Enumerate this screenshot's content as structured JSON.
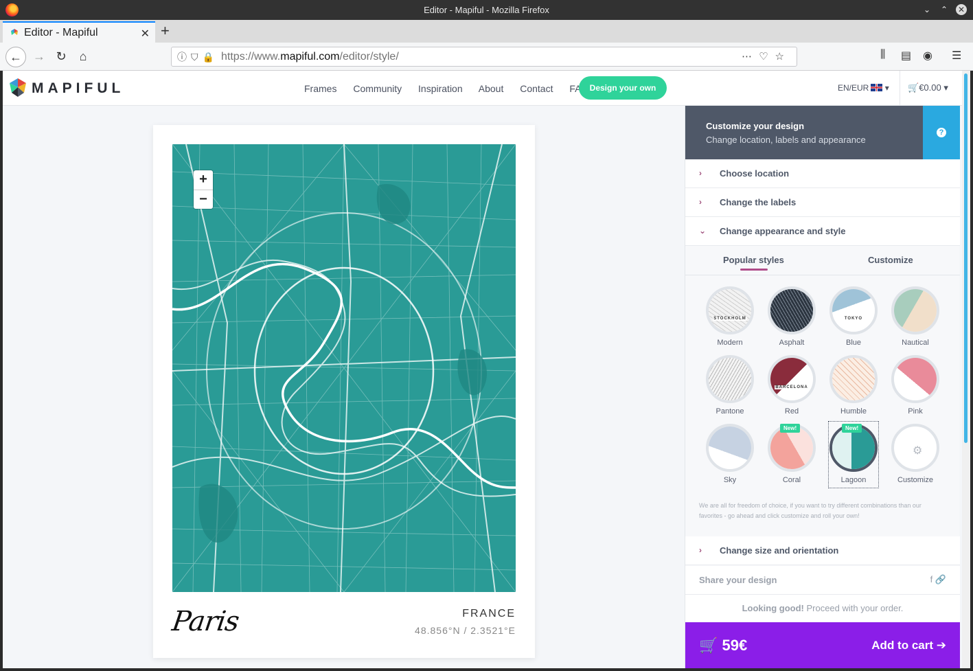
{
  "window": {
    "title": "Editor - Mapiful - Mozilla Firefox"
  },
  "browser": {
    "tab_title": "Editor - Mapiful",
    "url_prefix": "https://www.",
    "url_host": "mapiful.com",
    "url_path": "/editor/style/"
  },
  "site": {
    "brand": "MAPIFUL",
    "nav": [
      "Frames",
      "Community",
      "Inspiration",
      "About",
      "Contact",
      "FAQ"
    ],
    "cta": "Design your own",
    "lang": "EN/EUR",
    "cart": "€0.00"
  },
  "poster": {
    "city": "Paris",
    "country": "FRANCE",
    "coords": "48.856°N / 2.3521°E",
    "map_color": "#2a9b96"
  },
  "panel": {
    "head_title": "Customize your design",
    "head_sub": "Change location, labels and appearance",
    "sections": {
      "location": "Choose location",
      "labels": "Change the labels",
      "appearance": "Change appearance and style",
      "size": "Change size and orientation"
    },
    "tab_popular": "Popular styles",
    "tab_customize": "Customize",
    "styles": [
      {
        "name": "Modern",
        "text": "STOCKHOLM",
        "badge": ""
      },
      {
        "name": "Asphalt",
        "text": "",
        "badge": ""
      },
      {
        "name": "Blue",
        "text": "TOKYO",
        "badge": ""
      },
      {
        "name": "Nautical",
        "text": "",
        "badge": ""
      },
      {
        "name": "Pantone",
        "text": "",
        "badge": ""
      },
      {
        "name": "Red",
        "text": "BARCELONA",
        "badge": ""
      },
      {
        "name": "Humble",
        "text": "",
        "badge": ""
      },
      {
        "name": "Pink",
        "text": "",
        "badge": ""
      },
      {
        "name": "Sky",
        "text": "",
        "badge": ""
      },
      {
        "name": "Coral",
        "text": "",
        "badge": "New!"
      },
      {
        "name": "Lagoon",
        "text": "",
        "badge": "New!"
      },
      {
        "name": "Customize",
        "text": "",
        "badge": ""
      }
    ],
    "note": "We are all for freedom of choice, if you want to try different combinations than our favorites - go ahead and click customize and roll your own!",
    "share_label": "Share your design",
    "looking_bold": "Looking good!",
    "looking_rest": " Proceed with your order.",
    "price": "59€",
    "add_to_cart": "Add to cart"
  },
  "colors": {
    "accent_green": "#2fd39a",
    "buy_purple": "#8b1ee8",
    "header_slate": "#4f5868",
    "help_blue": "#2aa9e0"
  }
}
